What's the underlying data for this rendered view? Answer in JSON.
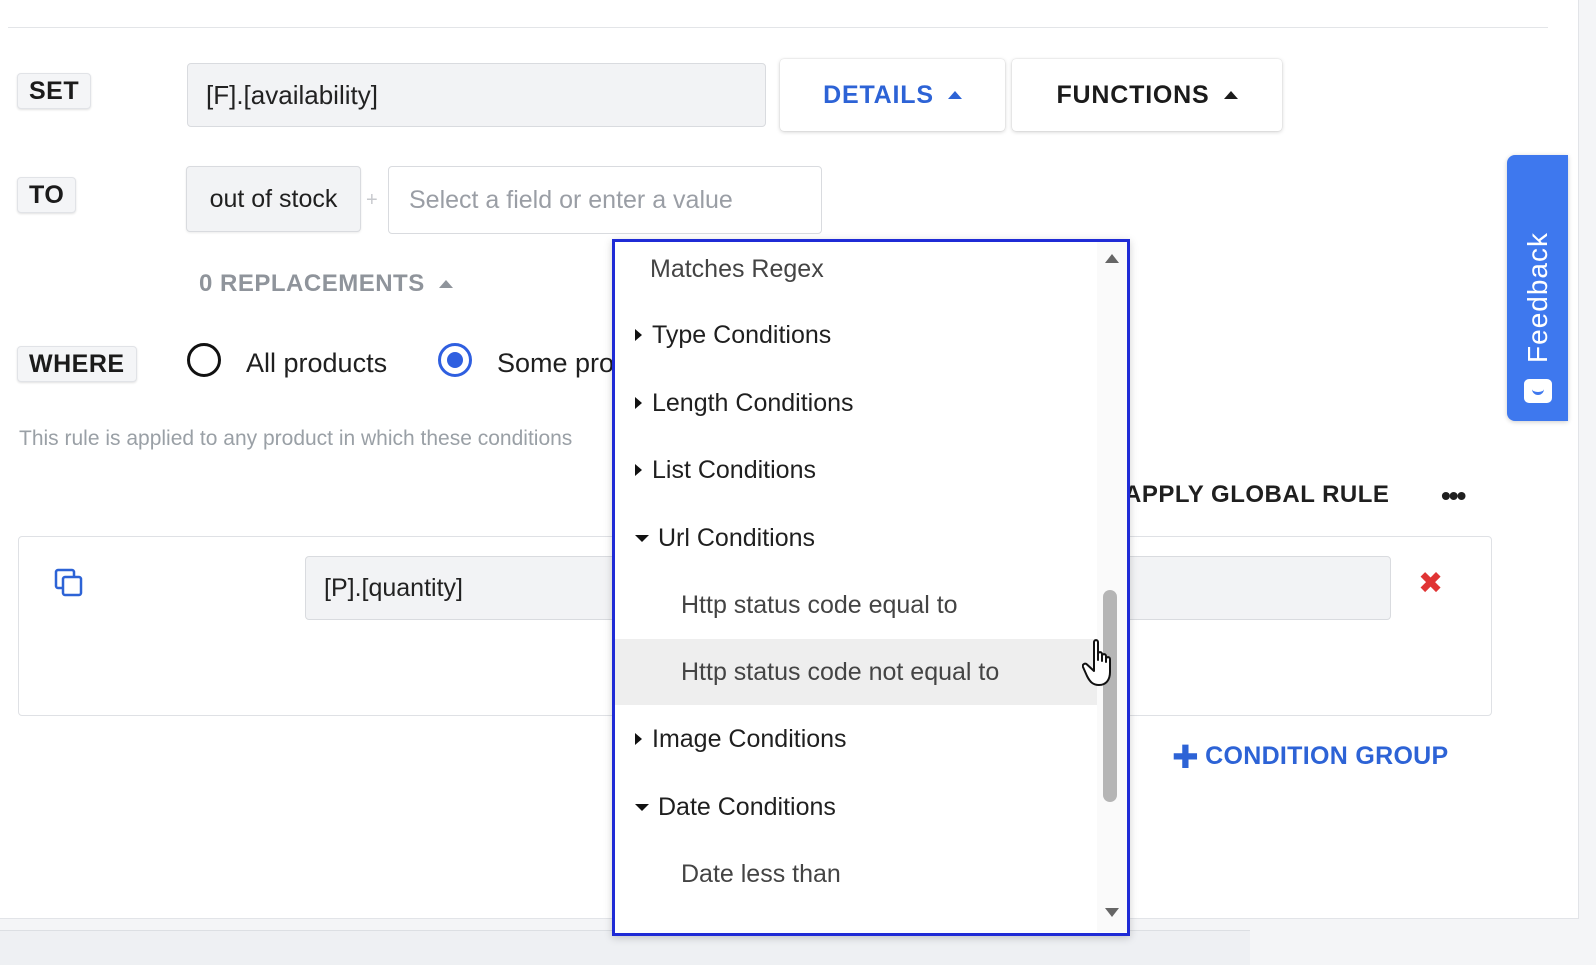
{
  "set": {
    "label": "SET",
    "field_value": "[F].[availability]"
  },
  "buttons": {
    "details": "DETAILS",
    "functions": "FUNCTIONS"
  },
  "to": {
    "label": "TO",
    "value_pill": "out of stock",
    "value_placeholder": "Select a field or enter a value"
  },
  "replacements": {
    "label": "0 REPLACEMENTS"
  },
  "where": {
    "label": "WHERE",
    "options": [
      {
        "label": "All products",
        "selected": false
      },
      {
        "label": "Some pro",
        "selected": true
      }
    ],
    "help_text": "This rule is applied to any product in which these conditions"
  },
  "rule_actions": {
    "apply_global": "APPLY GLOBAL RULE",
    "more": "•••"
  },
  "condition": {
    "field_value": "[P].[quantity]",
    "delete_icon": "close-icon",
    "copy_icon": "copy-icon"
  },
  "condition_group": {
    "label": "CONDITION GROUP"
  },
  "feedback": {
    "label": "Feedback"
  },
  "dropdown": {
    "items": [
      {
        "type": "option",
        "label": "Matches Regex"
      },
      {
        "type": "group",
        "label": "Type Conditions",
        "expanded": false
      },
      {
        "type": "group",
        "label": "Length Conditions",
        "expanded": false
      },
      {
        "type": "group",
        "label": "List Conditions",
        "expanded": false
      },
      {
        "type": "group",
        "label": "Url Conditions",
        "expanded": true
      },
      {
        "type": "option",
        "label": "Http status code equal to"
      },
      {
        "type": "option",
        "label": "Http status code not equal to",
        "hovered": true
      },
      {
        "type": "group",
        "label": "Image Conditions",
        "expanded": false
      },
      {
        "type": "group",
        "label": "Date Conditions",
        "expanded": true
      },
      {
        "type": "option",
        "label": "Date less than"
      }
    ]
  },
  "colors": {
    "accent": "#2d63d6",
    "dropdown_border": "#1f2bd6",
    "feedback": "#3e78ee",
    "delete": "#e03434"
  }
}
